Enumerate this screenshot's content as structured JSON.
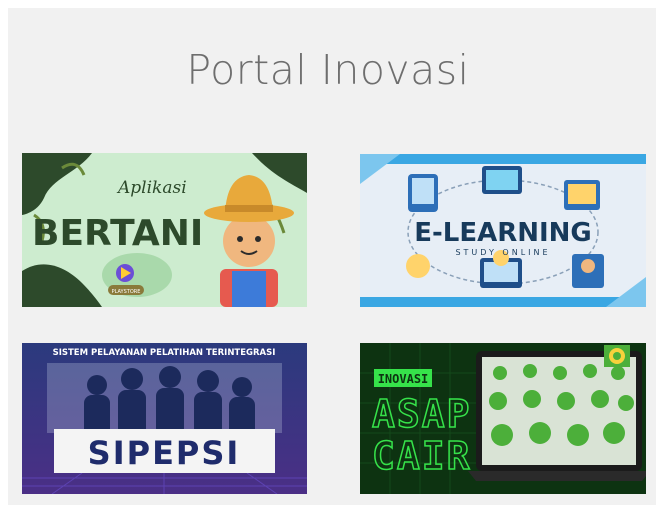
{
  "page": {
    "title": "Portal Inovasi"
  },
  "cards": {
    "bertani": {
      "script_text": "Aplikasi",
      "headline": "BERTANI",
      "badge_text": "PLAYSTORE",
      "colors": {
        "background": "#cdeccf",
        "accent": "#2d4a2b",
        "hat": "#e8a93b"
      }
    },
    "elearning": {
      "headline": "E-LEARNING",
      "subline": "STUDY ONLINE",
      "colors": {
        "background": "#e7eef6",
        "frame": "#3aa7e3",
        "text": "#173a5b"
      }
    },
    "sipepsi": {
      "top_text": "SISTEM PELAYANAN PELATIHAN TERINTEGRASI",
      "headline": "SIPEPSI",
      "colors": {
        "background": "#2b3a7d",
        "banner": "#f4f4f4",
        "text": "#1f2c6c"
      }
    },
    "asap": {
      "tag_text": "INOVASI",
      "line1": "ASAP",
      "line2": "CAIR",
      "colors": {
        "background": "#0d3311",
        "neon": "#36e24a",
        "accent": "#f7d23c"
      }
    }
  }
}
